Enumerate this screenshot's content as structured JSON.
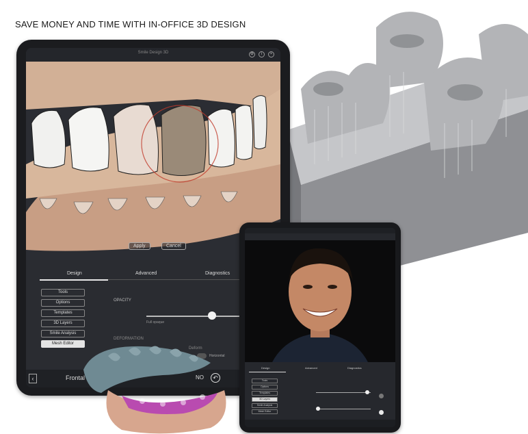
{
  "headline": "SAVE MONEY AND TIME WITH IN-OFFICE 3D DESIGN",
  "large_tablet": {
    "title": "Smile Design 3D",
    "viewport_buttons": {
      "apply": "Apply",
      "cancel": "Cancel"
    },
    "tabs": [
      "Design",
      "Advanced",
      "Diagnostics"
    ],
    "active_tab": "Design",
    "menu": [
      "Tools",
      "Options",
      "Templates",
      "3D Layers",
      "Smile Analysis",
      "Mesh Editor"
    ],
    "active_menu": "Mesh Editor",
    "opacity_label": "OPACITY",
    "slider_caption": "Full opaque",
    "opacity_value": 0.6,
    "deformation_label": "DEFORMATION",
    "deform_right": "Deform",
    "toggle_label": "Horizontal",
    "view_label": "Frontal",
    "bottom_right": "NO"
  },
  "small_tablet": {
    "tabs": [
      "Design",
      "Advanced",
      "Diagnostics"
    ],
    "menu": [
      "Tools",
      "Options",
      "Templates",
      "3D Layers",
      "Smile Analysis",
      "Mesh Editor"
    ],
    "active_menu": "3D Layers"
  },
  "colors": {
    "accent_red": "#c0392b",
    "printbed": "#a9aaad",
    "resin_teal": "#6f8a93",
    "resin_pink": "#b94bb0",
    "gum_model": "#d7a68e"
  }
}
